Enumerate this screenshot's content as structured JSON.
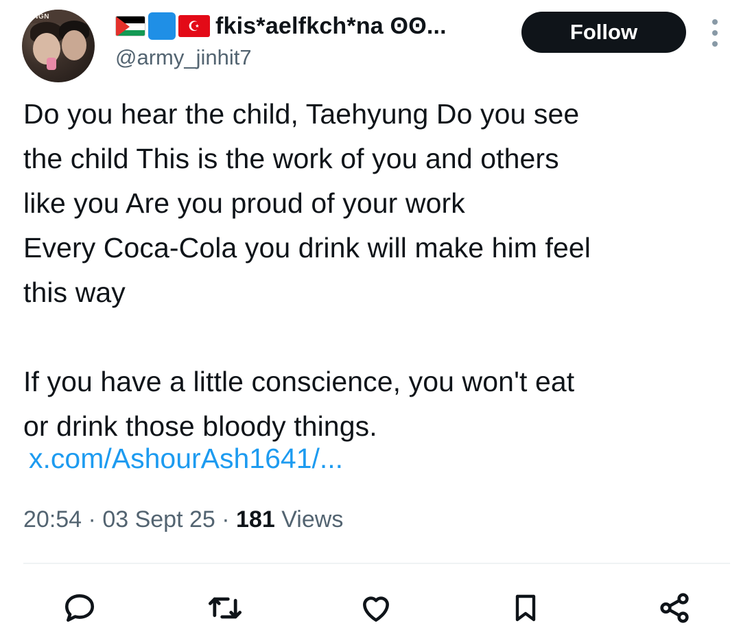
{
  "author": {
    "avatar_text": "ONGN",
    "display_name": "fkis*aelfkch*na ʘʘ...",
    "handle": "@army_jinhit7"
  },
  "follow_label": "Follow",
  "tweet": {
    "text": "Do you hear the child, Taehyung Do you see\nthe child This is the work of you and others\nlike you Are you proud of your work\nEvery Coca-Cola you drink will make him feel\nthis way\n\nIf you have a little conscience, you won't eat\nor drink those bloody things.",
    "link": "x.com/AshourAsh1641/...",
    "time": "20:54",
    "date": "03 Sept 25",
    "separator": "·",
    "views_count": "181",
    "views_label": "Views"
  },
  "icons": {
    "reply": "reply-icon",
    "retweet": "retweet-icon",
    "like": "heart-icon",
    "bookmark": "bookmark-icon",
    "share": "share-icon",
    "more": "more-vertical-icon"
  },
  "colors": {
    "text": "#0f1419",
    "muted": "#536471",
    "link": "#1d9bf0",
    "button_bg": "#0f1419"
  }
}
